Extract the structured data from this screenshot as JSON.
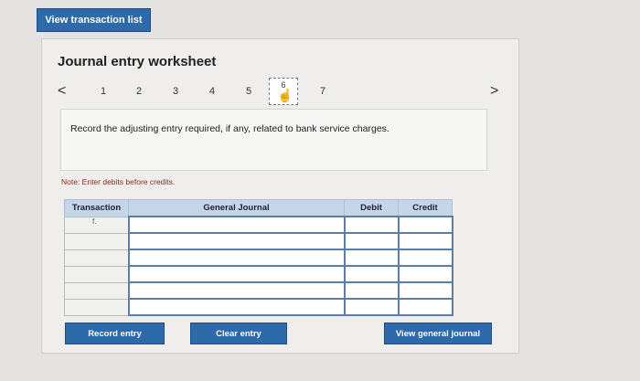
{
  "top_button": "View transaction list",
  "title": "Journal entry worksheet",
  "pagination": {
    "prev": "<",
    "next": ">",
    "pages": [
      "1",
      "2",
      "3",
      "4",
      "5",
      "6",
      "7"
    ]
  },
  "instruction": "Record the adjusting entry required, if any, related to bank service charges.",
  "note": "Note: Enter debits before credits.",
  "table": {
    "headers": {
      "transaction": "Transaction",
      "general_journal": "General Journal",
      "debit": "Debit",
      "credit": "Credit"
    },
    "rows": [
      {
        "transaction": "f."
      },
      {
        "transaction": ""
      },
      {
        "transaction": ""
      },
      {
        "transaction": ""
      },
      {
        "transaction": ""
      },
      {
        "transaction": ""
      }
    ]
  },
  "buttons": {
    "record": "Record entry",
    "clear": "Clear entry",
    "view_journal": "View general journal"
  }
}
